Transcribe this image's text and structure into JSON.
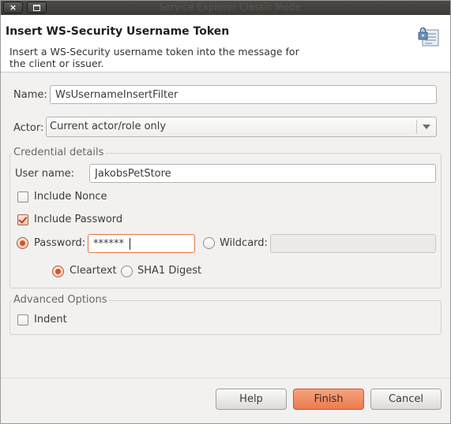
{
  "window": {
    "title": "Service Explorer Classic Mode",
    "close_glyph": "×"
  },
  "header": {
    "title": "Insert WS-Security Username Token",
    "description": "Insert a WS-Security username token into the message for the client or issuer.",
    "icon": "security-token-icon"
  },
  "form": {
    "name_label": "Name:",
    "name_value": "WsUsernameInsertFilter",
    "actor_label": "Actor:",
    "actor_value": "Current actor/role only"
  },
  "credentials": {
    "group_title": "Credential details",
    "username_label": "User name:",
    "username_value": "JakobsPetStore",
    "include_nonce_label": "Include Nonce",
    "include_nonce_checked": false,
    "include_password_label": "Include Password",
    "include_password_checked": true,
    "password_radio_label": "Password:",
    "password_radio_selected": true,
    "password_value": "******",
    "wildcard_radio_label": "Wildcard:",
    "wildcard_radio_selected": false,
    "wildcard_value": "",
    "cleartext_label": "Cleartext",
    "cleartext_selected": true,
    "digest_label": "SHA1 Digest",
    "digest_selected": false
  },
  "advanced": {
    "group_title": "Advanced Options",
    "indent_label": "Indent",
    "indent_checked": false
  },
  "buttons": {
    "help": "Help",
    "finish": "Finish",
    "cancel": "Cancel"
  },
  "colors": {
    "accent": "#e9743f",
    "primary_button": "#ec7c4f",
    "titlebar": "#3c3b37"
  }
}
